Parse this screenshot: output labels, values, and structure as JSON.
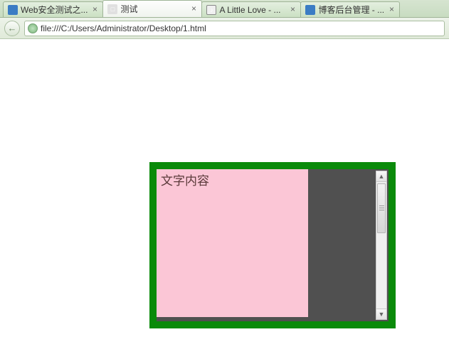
{
  "tabs": [
    {
      "title": "Web安全测试之...",
      "favicon": "fav-blue"
    },
    {
      "title": "测试",
      "favicon": "fav-file",
      "active": true
    },
    {
      "title": "A Little Love - ...",
      "favicon": "fav-music"
    },
    {
      "title": "博客后台管理 - ...",
      "favicon": "fav-blue"
    }
  ],
  "address_bar": {
    "url": "file:///C:/Users/Administrator/Desktop/1.html"
  },
  "page_content": {
    "pink_text": "文字内容"
  },
  "icons": {
    "back_arrow": "←",
    "close": "×",
    "scroll_up": "▲",
    "scroll_down": "▼",
    "music": "♪",
    "file": "□"
  }
}
